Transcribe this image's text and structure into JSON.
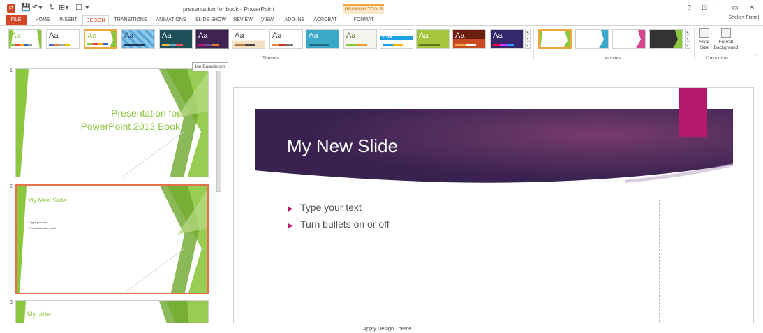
{
  "window": {
    "title": "presentation for book - PowerPoint",
    "contextual_tab_group": "DRAWING TOOLS",
    "user": "Shelley Fishel",
    "controls": "? ⊡ – ▭ ✕"
  },
  "tabs": [
    "FILE",
    "HOME",
    "INSERT",
    "DESIGN",
    "TRANSITIONS",
    "ANIMATIONS",
    "SLIDE SHOW",
    "REVIEW",
    "VIEW",
    "ADD-INS",
    "ACROBAT",
    "FORMAT"
  ],
  "ribbon": {
    "theme_aa": "Aa",
    "groups": {
      "themes": "Themes",
      "variants": "Variants",
      "customize": "Customize"
    },
    "buttons": {
      "slide_size": "Slide Size",
      "format_background": "Format Background"
    }
  },
  "tooltip": "Ion Boardroom",
  "thumbnails": [
    {
      "number": "1",
      "title_line1": "Presentation for",
      "title_line2": "PowerPoint 2013 Book"
    },
    {
      "number": "2",
      "title": "My New Slide",
      "bullet1": "Type your text",
      "bullet2": "Turn bullets on or off"
    },
    {
      "number": "3",
      "title": "My table"
    }
  ],
  "slide": {
    "title": "My New Slide",
    "bullets": [
      "Type your text",
      "Turn bullets on or off"
    ]
  },
  "status": "Apply Design Theme",
  "colors": {
    "accent": "#d24726",
    "green": "#8dc63f",
    "magenta": "#b5186d",
    "purple": "#3f2352"
  }
}
